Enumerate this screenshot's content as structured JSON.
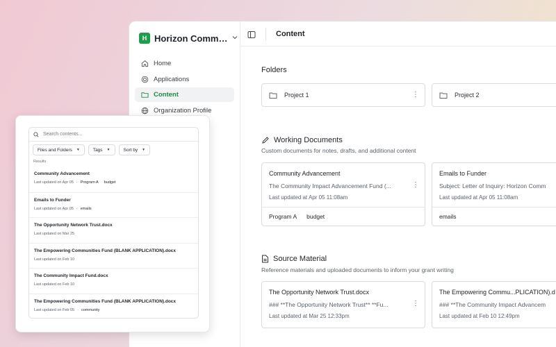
{
  "org": {
    "badge": "H",
    "name": "Horizon Commu..."
  },
  "sidebar": {
    "items": [
      {
        "label": "Home",
        "icon": "home-icon",
        "active": false
      },
      {
        "label": "Applications",
        "icon": "target-icon",
        "active": false
      },
      {
        "label": "Content",
        "icon": "folder-icon",
        "active": true
      },
      {
        "label": "Organization Profile",
        "icon": "globe-icon",
        "active": false
      }
    ]
  },
  "header": {
    "title": "Content"
  },
  "folders": {
    "heading": "Folders",
    "items": [
      {
        "name": "Project 1"
      },
      {
        "name": "Project 2"
      }
    ]
  },
  "working_documents": {
    "heading": "Working Documents",
    "subtitle": "Custom documents for notes, drafts, and additional content",
    "cards": [
      {
        "title": "Community Advancement",
        "preview": "The Community Impact Advancement Fund (...",
        "updated": "Last updated at Apr 05 11:08am",
        "tags": [
          "Program A",
          "budget"
        ]
      },
      {
        "title": "Emails to Funder",
        "preview": "Subject: Letter of Inquiry: Horizon Comm",
        "updated": "Last updated at Apr 05 11:08am",
        "tags": [
          "emails"
        ]
      }
    ]
  },
  "source_material": {
    "heading": "Source Material",
    "subtitle": "Reference materials and uploaded documents to inform your grant writing",
    "cards": [
      {
        "title": "The Opportunity Network Trust.docx",
        "preview": "### **The Opportunity Network Trust** **Fu...",
        "updated": "Last updated at Mar 25 12:33pm"
      },
      {
        "title": "The Empowering Commu...PLICATION).d",
        "preview": "### **The Community Impact Advancem",
        "updated": "Last updated at Feb 10 12:49pm"
      }
    ]
  },
  "search": {
    "placeholder": "Search contents...",
    "filters": [
      "Files and Folders",
      "Tags",
      "Sort by"
    ],
    "results_label": "Results",
    "results": [
      {
        "title": "Community Advancement",
        "updated": "Last updated on Apr 05",
        "tags": [
          "Program A",
          "budget"
        ]
      },
      {
        "title": "Emails to Funder",
        "updated": "Last updated on Apr 05",
        "tags": [
          "emails"
        ]
      },
      {
        "title": "The Opportunity Network Trust.docx",
        "updated": "Last updated on Mar 25",
        "tags": []
      },
      {
        "title": "The Empowering Communities Fund (BLANK APPLICATION).docx",
        "updated": "Last updated on Feb 10",
        "tags": []
      },
      {
        "title": "The Community Impact Fund.docx",
        "updated": "Last updated on Feb 10",
        "tags": []
      },
      {
        "title": "The Empowering Communities Fund (BLANK APPLICATION).docx",
        "updated": "Last updated on Feb 05",
        "tags": [
          "community"
        ]
      }
    ]
  },
  "colors": {
    "accent": "#1e9e4a",
    "accent_text": "#1d8a43",
    "border": "#d9dbdf"
  }
}
